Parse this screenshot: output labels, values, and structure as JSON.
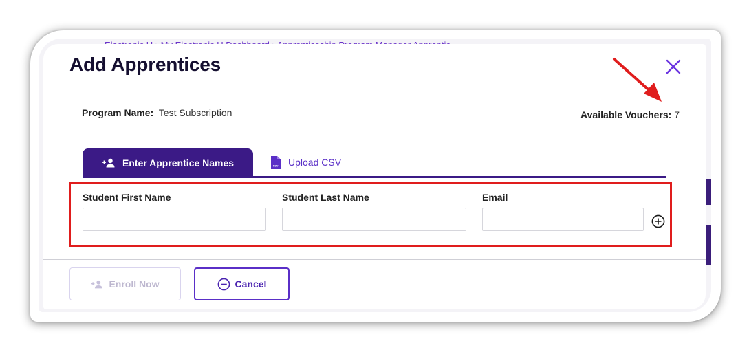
{
  "background": {
    "breadcrumb": [
      "Electronic U",
      "My Electronic U Dashboard",
      "Apprenticeship Program Manager Apprentic"
    ]
  },
  "modal": {
    "title": "Add Apprentices",
    "close_icon": "close-x-icon",
    "program_label": "Program Name:",
    "program_value": "Test Subscription",
    "vouchers_label": "Available Vouchers:",
    "vouchers_value": "7",
    "tabs": [
      {
        "label": "Enter Apprentice Names",
        "icon": "add-person-icon",
        "active": true
      },
      {
        "label": "Upload CSV",
        "icon": "csv-file-icon",
        "active": false
      }
    ],
    "fields": [
      {
        "label": "Student First Name",
        "value": "",
        "placeholder": ""
      },
      {
        "label": "Student Last Name",
        "value": "",
        "placeholder": ""
      },
      {
        "label": "Email",
        "value": "",
        "placeholder": ""
      }
    ],
    "add_row_icon": "plus-circle-icon",
    "buttons": {
      "enroll": {
        "label": "Enroll Now",
        "disabled": true,
        "icon": "add-person-icon"
      },
      "cancel": {
        "label": "Cancel",
        "icon": "minus-circle-icon"
      }
    }
  },
  "colors": {
    "brand_dark": "#3b1a86",
    "accent": "#5a2fc7",
    "annotation": "#e01d1d"
  }
}
